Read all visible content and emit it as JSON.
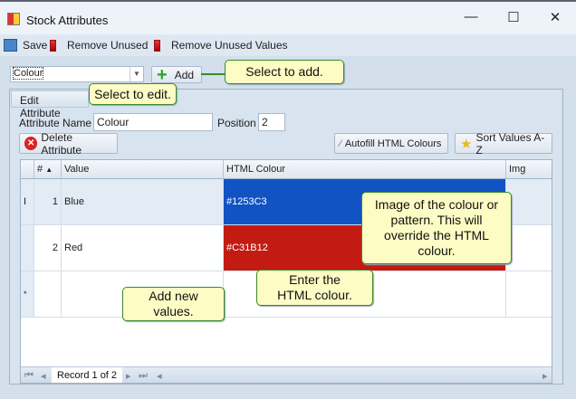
{
  "window": {
    "title": "Stock Attributes",
    "minimize": "—",
    "maximize": "☐",
    "close": "✕"
  },
  "toolbar": {
    "save": "Save",
    "remove_unused": "Remove Unused",
    "remove_unused_values": "Remove Unused Values"
  },
  "selector": {
    "value": "Colour",
    "add": "Add"
  },
  "group": {
    "title": "Edit Attribute"
  },
  "form": {
    "name_label": "Attribute Name",
    "name_value": "Colour",
    "position_label": "Position",
    "position_value": "2"
  },
  "buttons": {
    "delete": "Delete Attribute",
    "autofill": "Autofill HTML Colours",
    "sort": "Sort Values A-Z"
  },
  "grid": {
    "headers": {
      "num": "#",
      "value": "Value",
      "html": "HTML Colour",
      "img": "Img"
    },
    "rows": [
      {
        "num": "1",
        "value": "Blue",
        "html": "#1253C3",
        "color": "#1253C3",
        "indicator": "I"
      },
      {
        "num": "2",
        "value": "Red",
        "html": "#C31B12",
        "color": "#C31B12",
        "indicator": ""
      }
    ],
    "new_row_indicator": "*"
  },
  "navigator": {
    "record": "Record 1 of 2"
  },
  "callouts": {
    "add": "Select to add.",
    "edit": "Select to edit.",
    "img": "Image of the colour or pattern. This will override the HTML colour.",
    "html": "Enter the HTML colour.",
    "new": "Add new values."
  }
}
